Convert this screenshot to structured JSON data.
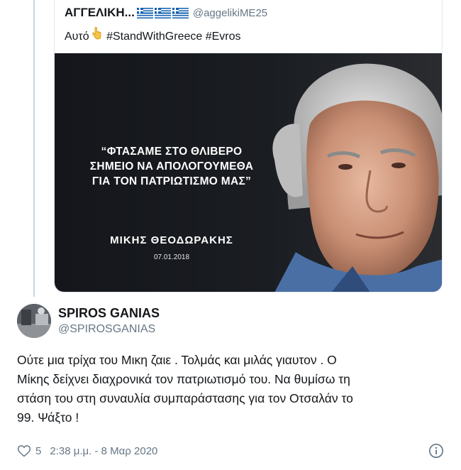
{
  "quoted_tweet": {
    "author_name": "ΑΓΓΕΛΙΚΗ...",
    "flags_icon": "greek-flag-icon",
    "author_handle": "@aggelikiME25",
    "text_before": "Αυτό",
    "emoji_icon": "pointing-down-hand-icon",
    "text_after": "#StandWithGreece #Evros",
    "image": {
      "quote_lines": [
        "“ΦΤΑΣΑΜΕ ΣΤΟ ΘΛΙΒΕΡΟ",
        "ΣΗΜΕΙΟ ΝΑ ΑΠΟΛΟΓΟΥΜΕΘΑ",
        "ΓΙΑ ΤΟΝ ΠΑΤΡΙΩΤΙΣΜΟ ΜΑΣ”"
      ],
      "author": "ΜΙΚΗΣ ΘΕΟΔΩΡΑΚΗΣ",
      "date": "07.01.2018"
    }
  },
  "tweet": {
    "author_name": "SPIROS GANIAS",
    "author_handle": "@SPIROSGANIAS",
    "text_lines": [
      "Ούτε μια τρίχα του Μικη ζαιε . Τολμάς και μιλάς γιαυτον . Ο",
      "Μίκης δείχνει διαχρονικά τον πατριωτισμό του. Να θυμίσω τη",
      "στάση του στη συναυλία συμπαράστασης για τον Οτσαλάν το",
      "99. Ψάξτο !"
    ],
    "like_count": "5",
    "timestamp": "2:38 μ.μ. - 8 Μαρ 2020"
  },
  "colors": {
    "text": "#14171a",
    "secondary": "#657786",
    "border": "#e1e8ed",
    "thread_line": "#ccd6dd",
    "flag_blue": "#0d5eaf"
  }
}
